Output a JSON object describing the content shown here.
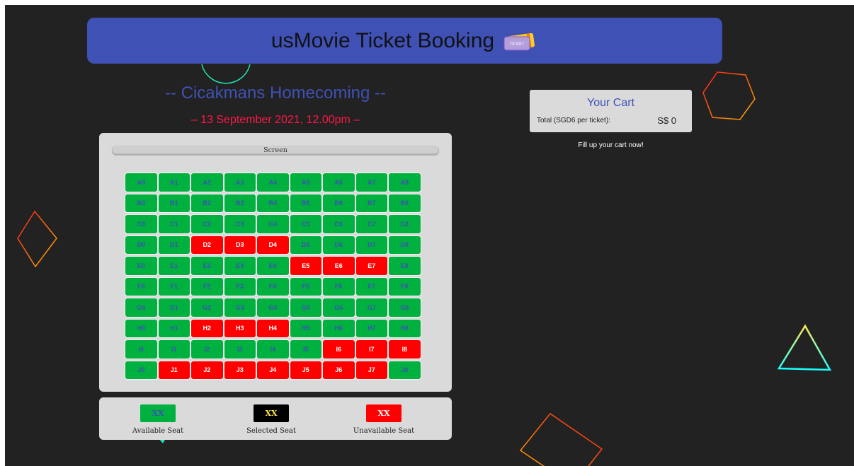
{
  "header": {
    "title": "usMovie Ticket Booking",
    "icon": "ticket-icon",
    "icon_text": "TICKET"
  },
  "movie": {
    "title": "-- Cicakmans Homecoming --",
    "datetime": "– 13 September 2021, 12.00pm –"
  },
  "screen_label": "Screen",
  "seats": {
    "rows": [
      "A",
      "B",
      "C",
      "D",
      "E",
      "F",
      "G",
      "H",
      "I",
      "J"
    ],
    "columns": [
      0,
      1,
      2,
      3,
      4,
      5,
      6,
      7,
      8
    ],
    "unavailable": [
      "D2",
      "D3",
      "D4",
      "E5",
      "E6",
      "E7",
      "H2",
      "H3",
      "H4",
      "I6",
      "I7",
      "I8",
      "J1",
      "J2",
      "J3",
      "J4",
      "J5",
      "J6",
      "J7"
    ]
  },
  "legend": {
    "available": {
      "swatch": "XX",
      "label": "Available Seat"
    },
    "selected": {
      "swatch": "XX",
      "label": "Selected Seat"
    },
    "unavailable": {
      "swatch": "XX",
      "label": "Unavailable Seat"
    }
  },
  "cart": {
    "title": "Your Cart",
    "total_label": "Total (SGD6 per ticket):",
    "total_value": "S$ 0",
    "empty_message": "Fill up your cart now!"
  },
  "colors": {
    "background": "#222222",
    "accent": "#3f51b5",
    "available": "#00b140",
    "unavailable": "#ff0000",
    "selected": "#000000",
    "selected_text": "#ffeb3b",
    "date": "#ff1744"
  }
}
